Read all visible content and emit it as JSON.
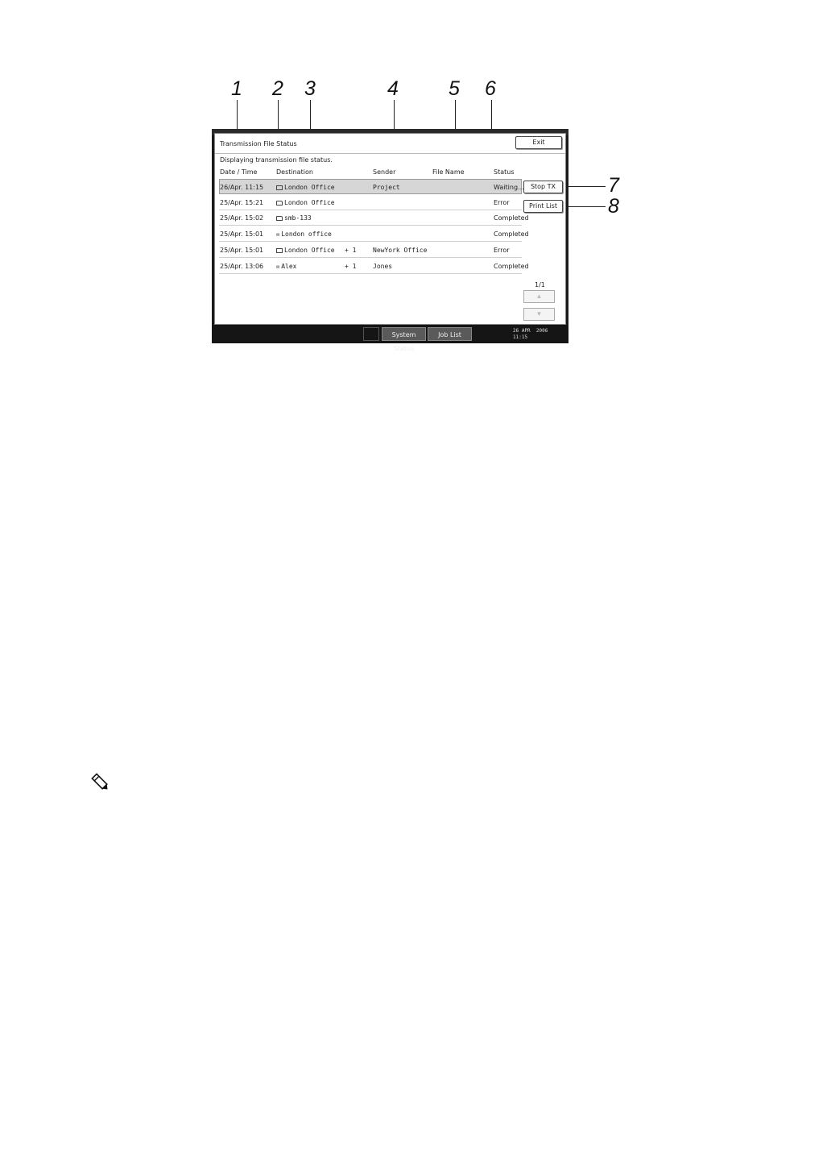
{
  "callouts": [
    "1",
    "2",
    "3",
    "4",
    "5",
    "6",
    "7",
    "8"
  ],
  "screen": {
    "title": "Transmission File Status",
    "exit_label": "Exit",
    "subtitle": "Displaying transmission file status.",
    "columns": {
      "date_time": "Date / Time",
      "destination": "Destination",
      "sender": "Sender",
      "file_name": "File Name",
      "status": "Status"
    },
    "rows": [
      {
        "date": "26/Apr. 11:15",
        "icon": "fax-icon",
        "destination": "London Office",
        "extra": "",
        "sender": "Project",
        "file_name": "",
        "status": "Waiting...",
        "selected": true
      },
      {
        "date": "25/Apr. 15:21",
        "icon": "folder-icon",
        "destination": "London Office",
        "extra": "",
        "sender": "",
        "file_name": "",
        "status": "Error",
        "selected": false
      },
      {
        "date": "25/Apr. 15:02",
        "icon": "folder-icon",
        "destination": "smb-133",
        "extra": "",
        "sender": "",
        "file_name": "",
        "status": "Completed",
        "selected": false
      },
      {
        "date": "25/Apr. 15:01",
        "icon": "email-icon",
        "destination": "London office",
        "extra": "",
        "sender": "",
        "file_name": "",
        "status": "Completed",
        "selected": false
      },
      {
        "date": "25/Apr. 15:01",
        "icon": "fax-icon",
        "destination": "London Office",
        "extra": "+ 1",
        "sender": "NewYork Office",
        "file_name": "",
        "status": "Error",
        "selected": false
      },
      {
        "date": "25/Apr. 13:06",
        "icon": "email-icon",
        "destination": "Alex",
        "extra": "+ 1",
        "sender": "Jones",
        "file_name": "",
        "status": "Completed",
        "selected": false
      }
    ],
    "stop_tx_label": "Stop TX",
    "print_list_label": "Print List",
    "page_indicator": "1/1",
    "scroll_up": "▲",
    "scroll_down": "▼",
    "tabs": {
      "system_status": "System Status",
      "job_list": "Job List"
    },
    "clock": "26 APR  2006\n11:15"
  }
}
